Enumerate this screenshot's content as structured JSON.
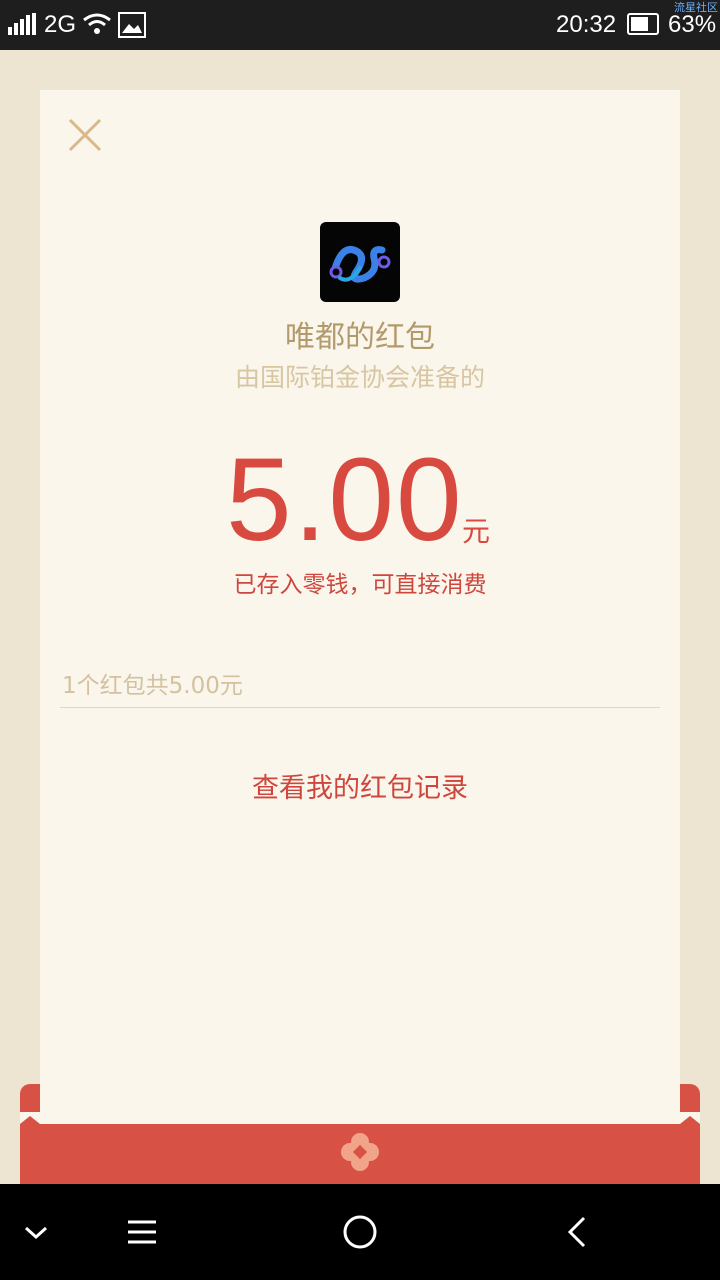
{
  "status_bar": {
    "network": "2G",
    "time": "20:32",
    "battery_pct": "63%",
    "battery_level": 0.63,
    "watermark": "流星社区"
  },
  "dialog": {
    "title": "唯都的红包",
    "subtitle": "由国际铂金协会准备的",
    "amount": "5.00",
    "unit": "元",
    "note": "已存入零钱，可直接消费",
    "summary": "1个红包共5.00元",
    "record_link": "查看我的红包记录"
  },
  "nav_bar": {
    "icons": [
      "chevron-down-icon",
      "menu-icon",
      "home-icon",
      "back-icon"
    ]
  }
}
